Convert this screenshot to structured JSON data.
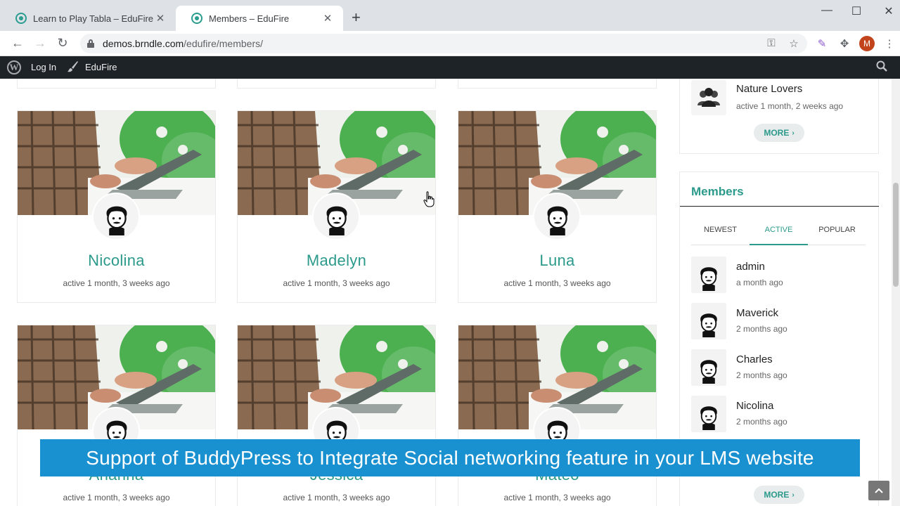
{
  "browser": {
    "tabs": [
      {
        "title": "Learn to Play Tabla – EduFire",
        "active": false
      },
      {
        "title": "Members – EduFire",
        "active": true
      }
    ],
    "new_tab_icon": "plus-icon",
    "url_host": "demos.brndle.com",
    "url_path": "/edufire/members/",
    "profile_initial": "M",
    "profile_color": "#c1441c"
  },
  "adminbar": {
    "login_label": "Log In",
    "site_label": "EduFire"
  },
  "members_grid": [
    {
      "name": "Nicolina",
      "active": "active 1 month, 3 weeks ago"
    },
    {
      "name": "Madelyn",
      "active": "active 1 month, 3 weeks ago"
    },
    {
      "name": "Luna",
      "active": "active 1 month, 3 weeks ago"
    },
    {
      "name": "Ananna",
      "active": "active 1 month, 3 weeks ago"
    },
    {
      "name": "Jessica",
      "active": "active 1 month, 3 weeks ago"
    },
    {
      "name": "Mateo",
      "active": "active 1 month, 3 weeks ago"
    }
  ],
  "groups_widget": {
    "group_name": "Nature Lovers",
    "group_active": "active 1 month, 2 weeks ago",
    "more_label": "MORE"
  },
  "members_widget": {
    "title": "Members",
    "tabs": [
      "NEWEST",
      "ACTIVE",
      "POPULAR"
    ],
    "selected_tab": "ACTIVE",
    "members": [
      {
        "name": "admin",
        "time": "a month ago"
      },
      {
        "name": "Maverick",
        "time": "2 months ago"
      },
      {
        "name": "Charles",
        "time": "2 months ago"
      },
      {
        "name": "Nicolina",
        "time": "2 months ago"
      }
    ],
    "more_label": "MORE"
  },
  "banner_text": "Support of BuddyPress to Integrate Social networking feature in your LMS website",
  "colors": {
    "accent": "#2b9a8b",
    "banner": "#1990cf",
    "adminbar": "#1d2327"
  }
}
